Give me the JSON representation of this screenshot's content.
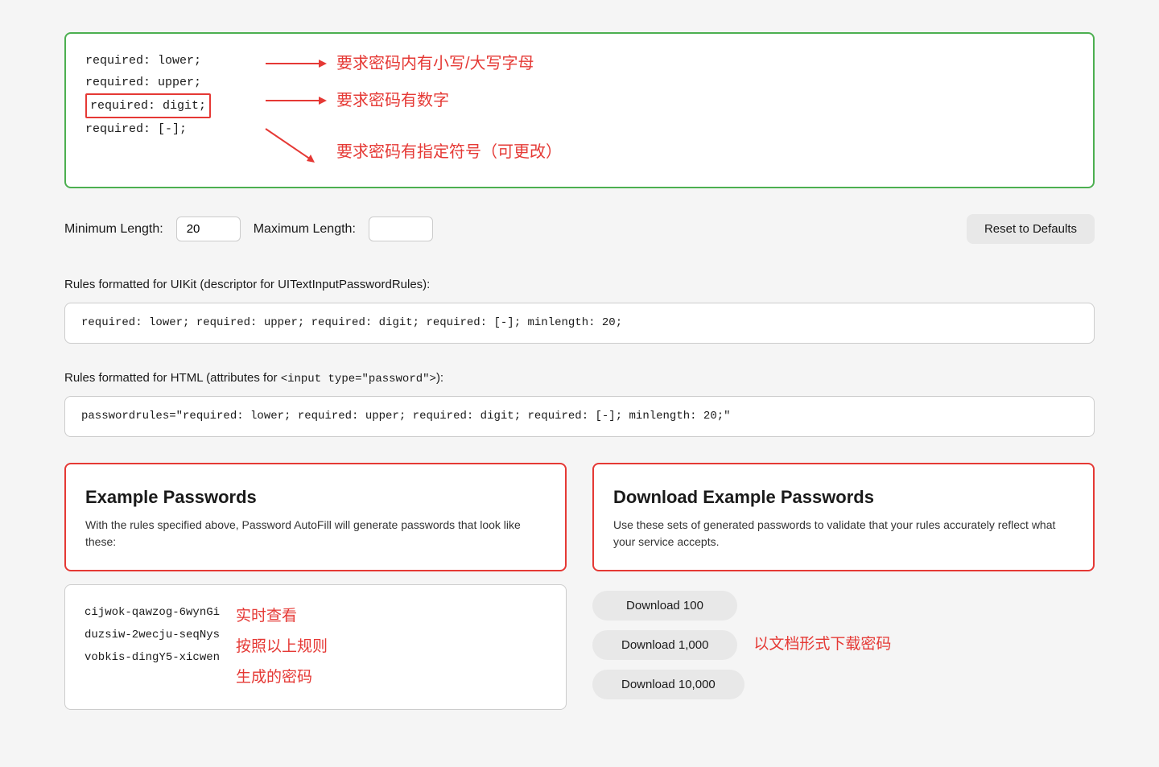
{
  "annotation": {
    "lines": [
      {
        "text": "required: lower;",
        "highlighted": false
      },
      {
        "text": "required: upper;",
        "highlighted": false
      },
      {
        "text": "required: digit;",
        "highlighted": true
      },
      {
        "text": "required: [-];",
        "highlighted": false
      }
    ],
    "arrow_labels": [
      {
        "arrow": "→",
        "text": "要求密码内有小写/大写字母"
      },
      {
        "arrow": "→",
        "text": "要求密码有数字"
      },
      {
        "arrow": "↘",
        "text": "要求密码有指定符号（可更改）"
      }
    ]
  },
  "length_row": {
    "min_label": "Minimum Length:",
    "min_value": "20",
    "max_label": "Maximum Length:",
    "max_value": "",
    "reset_label": "Reset to Defaults"
  },
  "uikit_section": {
    "label": "Rules formatted for UIKit (descriptor for UITextInputPasswordRules):",
    "value": "required: lower; required: upper; required: digit; required: [-]; minlength: 20;"
  },
  "html_section": {
    "label_prefix": "Rules formatted for HTML (attributes for ",
    "label_code": "<input type=\"password\">",
    "label_suffix": "):",
    "value": "passwordrules=\"required: lower; required: upper; required: digit; required: [-]; minlength: 20;\""
  },
  "example_panel": {
    "title": "Example Passwords",
    "desc": "With the rules specified above, Password AutoFill will generate passwords that look like these:"
  },
  "download_panel": {
    "title": "Download Example Passwords",
    "desc": "Use these sets of generated passwords to validate that your rules accurately reflect what your service accepts."
  },
  "example_passwords": {
    "passwords": [
      "cijwok-qawzog-6wynGi",
      "duzsiw-2wecju-seqNys",
      "vobkis-dingY5-xicwen"
    ],
    "annotation": "实时查看\n按照以上规则\n生成的密码"
  },
  "download_buttons": {
    "buttons": [
      {
        "label": "Download 100"
      },
      {
        "label": "Download 1,000"
      },
      {
        "label": "Download 10,000"
      }
    ],
    "annotation": "以文档形式下载密码"
  }
}
